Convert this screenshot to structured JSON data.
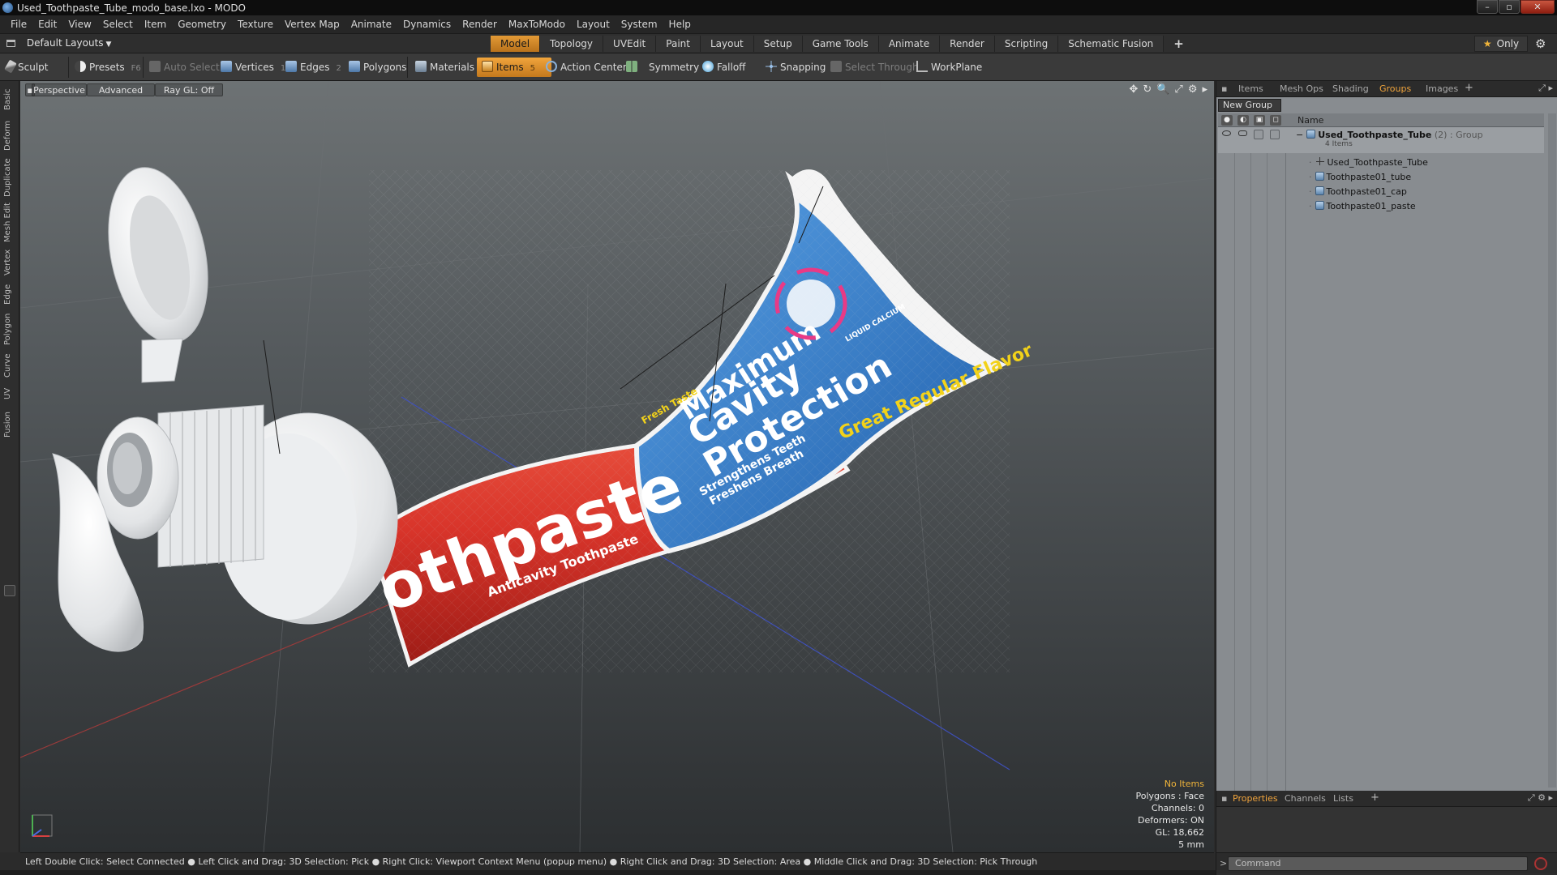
{
  "window": {
    "title": "Used_Toothpaste_Tube_modo_base.lxo - MODO",
    "buttons": [
      "–",
      "▫",
      "✕"
    ]
  },
  "menu": [
    "File",
    "Edit",
    "View",
    "Select",
    "Item",
    "Geometry",
    "Texture",
    "Vertex Map",
    "Animate",
    "Dynamics",
    "Render",
    "MaxToModo",
    "Layout",
    "System",
    "Help"
  ],
  "layoutbar": {
    "layouts_label": "Default Layouts",
    "tabs": [
      "Model",
      "Topology",
      "UVEdit",
      "Paint",
      "Layout",
      "Setup",
      "Game Tools",
      "Animate",
      "Render",
      "Scripting",
      "Schematic Fusion"
    ],
    "active_tab": "Model",
    "plus": "+",
    "only_label": "Only",
    "only_star": "★",
    "gear": "⚙"
  },
  "toolbar": {
    "sculpt": "Sculpt",
    "presets": "Presets",
    "presets_key": "F6",
    "auto_select": "Auto Select",
    "vertices": "Vertices",
    "vertices_count": "1",
    "edges": "Edges",
    "edges_count": "2",
    "polygons": "Polygons",
    "materials": "Materials",
    "items": "Items",
    "items_count": "5",
    "action_center": "Action Center",
    "symmetry": "Symmetry",
    "falloff": "Falloff",
    "snapping": "Snapping",
    "select_through": "Select Through",
    "workplane": "WorkPlane"
  },
  "left_tabs": [
    "Basic",
    "Deform",
    "Duplicate",
    "Mesh Edit",
    "Vertex",
    "Edge",
    "Polygon",
    "Curve",
    "UV",
    "Fusion"
  ],
  "viewport": {
    "view_mode": "Perspective",
    "shading": "Advanced",
    "raygl": "Ray GL: Off",
    "icons": [
      "✥",
      "↻",
      "🔍",
      "⤢",
      "⚙",
      "▸"
    ],
    "stats": {
      "selection": "No Items",
      "polygons": "Polygons : Face",
      "channels": "Channels: 0",
      "deformers": "Deformers: ON",
      "gl": "GL: 18,662",
      "scale": "5 mm"
    },
    "label_art": {
      "brand": "othpaste",
      "tagline": "Anticavity Toothpaste",
      "headline1": "Maximum",
      "headline2": "Cavity",
      "headline3": "Protection",
      "benefit1": "Strengthens Teeth",
      "benefit2": "Freshens Breath",
      "flavor": "Great Regular Flavor",
      "burst": "Fresh Taste",
      "badge": "LIQUID CALCIUM"
    }
  },
  "statusbar": "Left Double Click: Select Connected ● Left Click and Drag: 3D Selection: Pick ● Right Click: Viewport Context Menu (popup menu) ● Right Click and Drag: 3D Selection: Area ● Middle Click and Drag: 3D Selection: Pick Through",
  "right_top_tabs": [
    "Items",
    "Mesh Ops",
    "Shading",
    "Groups",
    "Images"
  ],
  "right_top_active": "Groups",
  "groups": {
    "new_group": "New Group",
    "column_name": "Name",
    "group_name": "Used_Toothpaste_Tube",
    "group_meta": "(2) : Group",
    "group_count": "4 Items",
    "children": [
      "Used_Toothpaste_Tube",
      "Toothpaste01_tube",
      "Toothpaste01_cap",
      "Toothpaste01_paste"
    ]
  },
  "right_bottom_tabs": [
    "Properties",
    "Channels",
    "Lists"
  ],
  "right_bottom_active": "Properties",
  "command": {
    "prompt": ">",
    "placeholder": "Command"
  },
  "colors": {
    "accent": "#f0a43c",
    "tube_red": "#d8342a",
    "tube_blue": "#2f78c8",
    "label_yellow": "#f2d21a"
  }
}
